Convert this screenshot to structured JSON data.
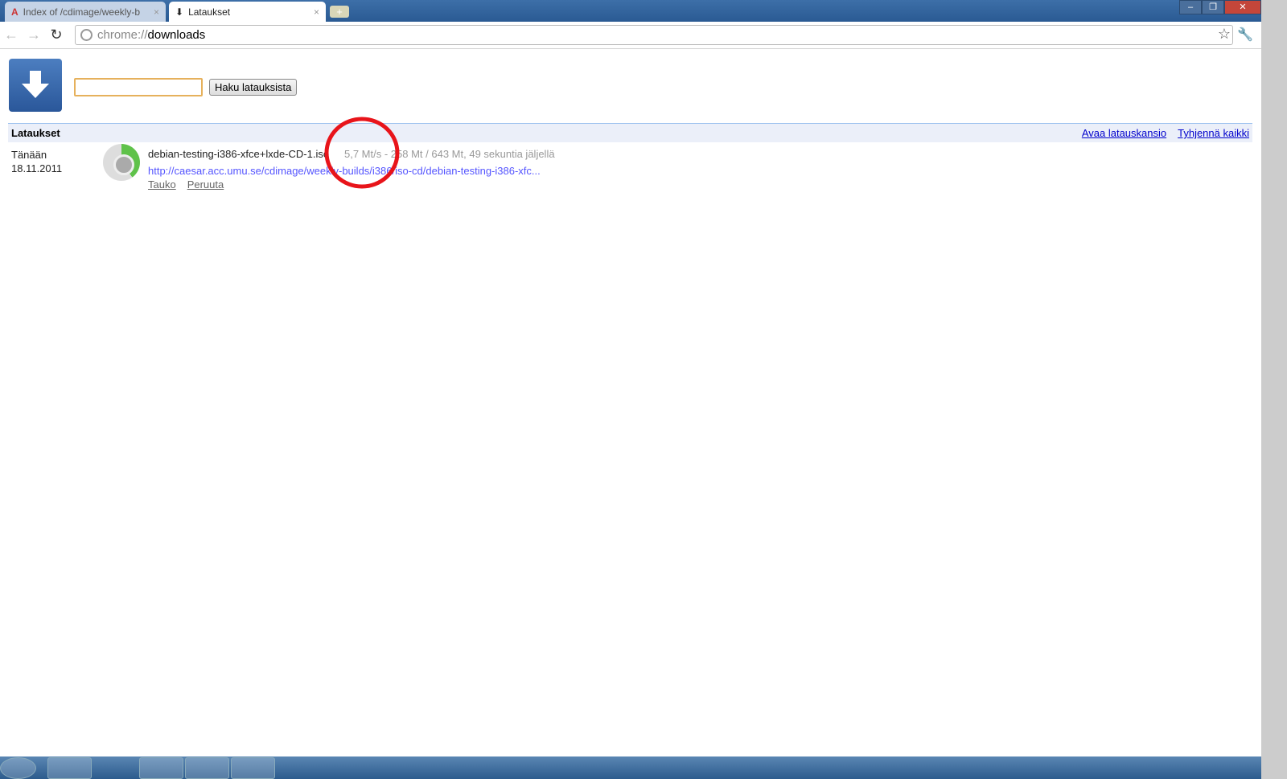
{
  "tabs": [
    {
      "label": "Index of /cdimage/weekly-b"
    },
    {
      "label": "Lataukset"
    }
  ],
  "omnibox": {
    "scheme": "chrome://",
    "path": "downloads"
  },
  "search": {
    "value": "",
    "button": "Haku latauksista"
  },
  "header": {
    "title": "Lataukset",
    "open_folder": "Avaa latauskansio",
    "clear_all": "Tyhjennä kaikki"
  },
  "download": {
    "day": "Tänään",
    "date": "18.11.2011",
    "filename": "debian-testing-i386-xfce+lxde-CD-1.iso",
    "status": "5,7 Mt/s - 258 Mt / 643 Mt, 49 sekuntia jäljellä",
    "progress": 0.4,
    "url": "http://caesar.acc.umu.se/cdimage/weekly-builds/i386/iso-cd/debian-testing-i386-xfc...",
    "pause": "Tauko",
    "cancel": "Peruuta"
  },
  "colors": {
    "link": "#0000cc",
    "annotation": "#e8141a"
  }
}
